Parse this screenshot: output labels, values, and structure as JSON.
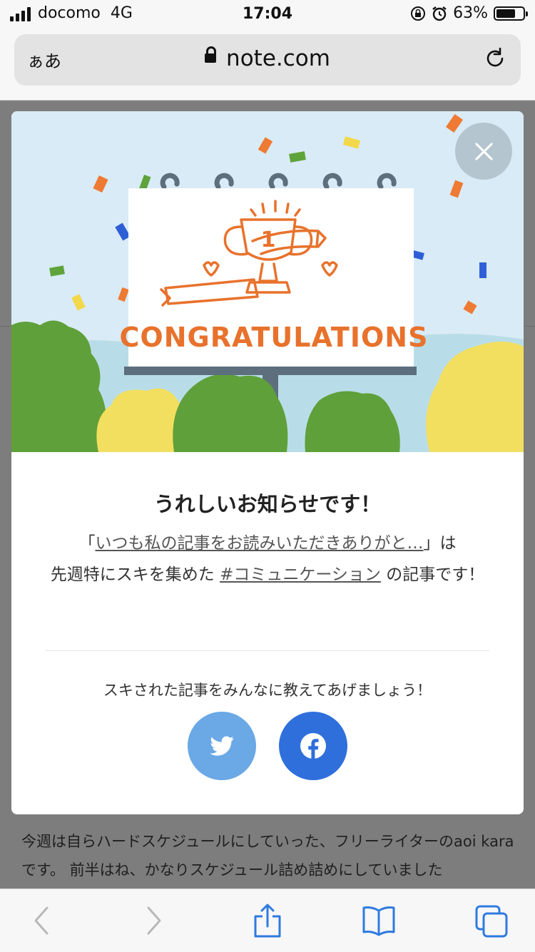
{
  "status_bar": {
    "carrier": "docomo",
    "network": "4G",
    "time": "17:04",
    "battery": "63%"
  },
  "browser": {
    "text_size_label": "ぁあ",
    "domain": "note.com"
  },
  "background_article": {
    "text": "今週は自らハードスケジュールにしていった、フリーライターのaoi karaです。 前半はね、かなりスケジュール詰め詰めにしていました"
  },
  "modal": {
    "banner_text": "CONGRATULATIONS",
    "headline": "うれしいお知らせです！",
    "message_prefix": "「",
    "article_title": "いつも私の記事をお読みいただきありがと…",
    "message_mid1": "」は",
    "message_mid2": "先週特にスキを集めた",
    "hashtag": "#コミュニケーション",
    "message_suffix": "の記事です！",
    "share_prompt": "スキされた記事をみんなに教えてあげましょう！"
  },
  "colors": {
    "twitter": "#6aa8e6",
    "facebook": "#2f6fdc",
    "banner_orange": "#e8722c"
  },
  "icons": [
    "close-icon",
    "twitter-icon",
    "facebook-icon",
    "lock-icon",
    "reload-icon",
    "back-icon",
    "forward-icon",
    "share-icon",
    "bookmarks-icon",
    "tabs-icon"
  ]
}
